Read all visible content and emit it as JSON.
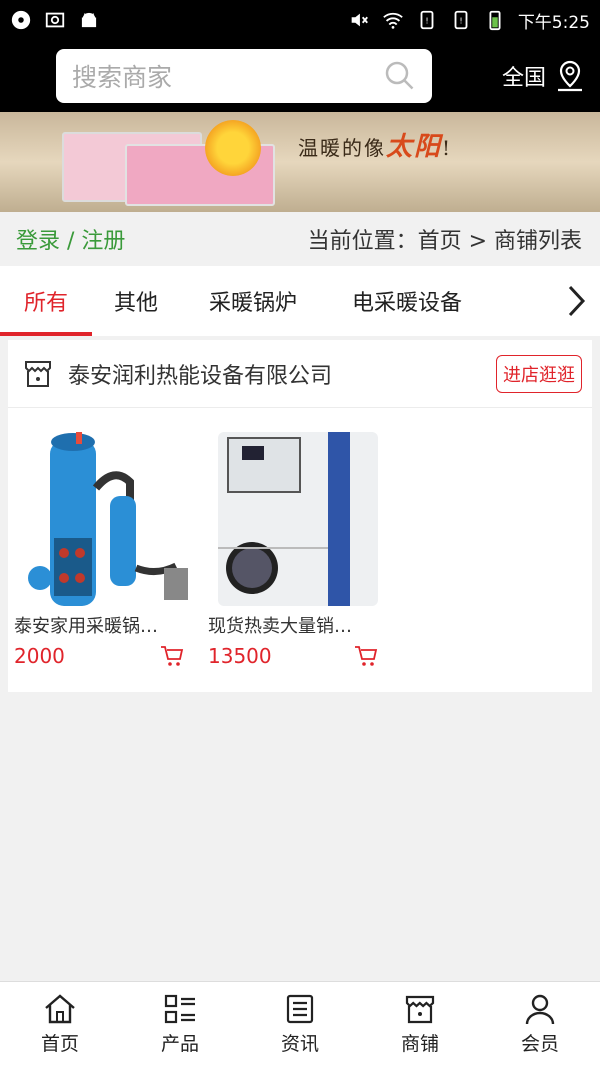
{
  "status_bar": {
    "time": "下午5:25"
  },
  "header": {
    "search_placeholder": "搜索商家",
    "region_label": "全国"
  },
  "banner": {
    "slogan_a": "温暖的像",
    "slogan_b": "太阳",
    "slogan_c": "!"
  },
  "crumbs": {
    "login": "登录 / 注册",
    "location": "当前位置：首页 > 商铺列表"
  },
  "tabs": [
    "所有",
    "其他",
    "采暖锅炉",
    "电采暖设备"
  ],
  "shop": {
    "name": "泰安润利热能设备有限公司",
    "visit_label": "进店逛逛",
    "products": [
      {
        "title": "泰安家用采暖锅…",
        "price": "2000"
      },
      {
        "title": "现货热卖大量销…",
        "price": "13500"
      }
    ]
  },
  "bottom_nav": [
    "首页",
    "产品",
    "资讯",
    "商铺",
    "会员"
  ],
  "colors": {
    "accent": "#e0242b",
    "login_green": "#3a9a3a"
  }
}
